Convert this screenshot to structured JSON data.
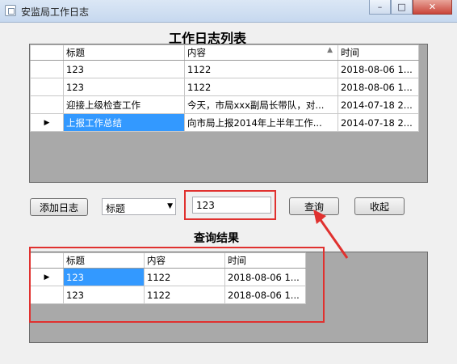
{
  "window": {
    "title": "安监局工作日志",
    "min_label": "–",
    "max_label": "□",
    "close_label": "✕"
  },
  "log_list": {
    "heading": "工作日志列表",
    "columns": [
      "标题",
      "内容",
      "时间"
    ],
    "rows": [
      {
        "indicator": "",
        "title": "123",
        "content": "1122",
        "time": "2018-08-06 1..."
      },
      {
        "indicator": "",
        "title": "123",
        "content": "1122",
        "time": "2018-08-06 1..."
      },
      {
        "indicator": "",
        "title": "迎接上级检查工作",
        "content": "今天，市局xxx副局长带队，对...",
        "time": "2014-07-18 2..."
      },
      {
        "indicator": "▶",
        "title": "上报工作总结",
        "content": "向市局上报2014年上半年工作...",
        "time": "2014-07-18 2..."
      }
    ],
    "selected_row": 3
  },
  "toolbar": {
    "add_label": "添加日志",
    "field_select_value": "标题",
    "search_value": "123",
    "query_label": "查询",
    "collapse_label": "收起"
  },
  "results": {
    "heading": "查询结果",
    "columns": [
      "标题",
      "内容",
      "时间"
    ],
    "rows": [
      {
        "indicator": "▶",
        "title": "123",
        "content": "1122",
        "time": "2018-08-06 1..."
      },
      {
        "indicator": "",
        "title": "123",
        "content": "1122",
        "time": "2018-08-06 1..."
      }
    ]
  },
  "annotation_color": "#e0312f",
  "selection_color": "#3399ff"
}
